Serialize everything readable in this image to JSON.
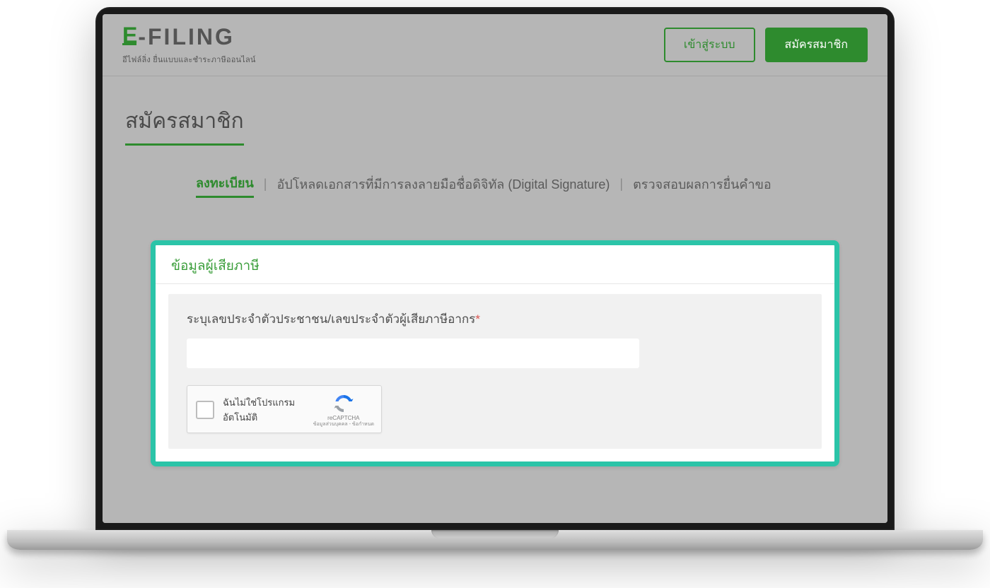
{
  "logo": {
    "e": "E",
    "filing": "-FILING",
    "sub": "อีไฟล์ลิ่ง ยื่นแบบและชำระภาษีออนไลน์"
  },
  "header": {
    "login": "เข้าสู่ระบบ",
    "register": "สมัครสมาชิก"
  },
  "page": {
    "title": "สมัครสมาชิก"
  },
  "tabs": {
    "register": "ลงทะเบียน",
    "upload": "อัปโหลดเอกสารที่มีการลงลายมือชื่อดิจิทัล (Digital Signature)",
    "check": "ตรวจสอบผลการยื่นคำขอ"
  },
  "card": {
    "title": "ข้อมูลผู้เสียภาษี",
    "field_label": "ระบุเลขประจำตัวประชาชน/เลขประจำตัวผู้เสียภาษีอากร",
    "required": "*",
    "input_value": ""
  },
  "recaptcha": {
    "label": "ฉันไม่ใช่โปรแกรมอัตโนมัติ",
    "brand": "reCAPTCHA",
    "terms": "ข้อมูลส่วนบุคคล - ข้อกำหนด"
  }
}
